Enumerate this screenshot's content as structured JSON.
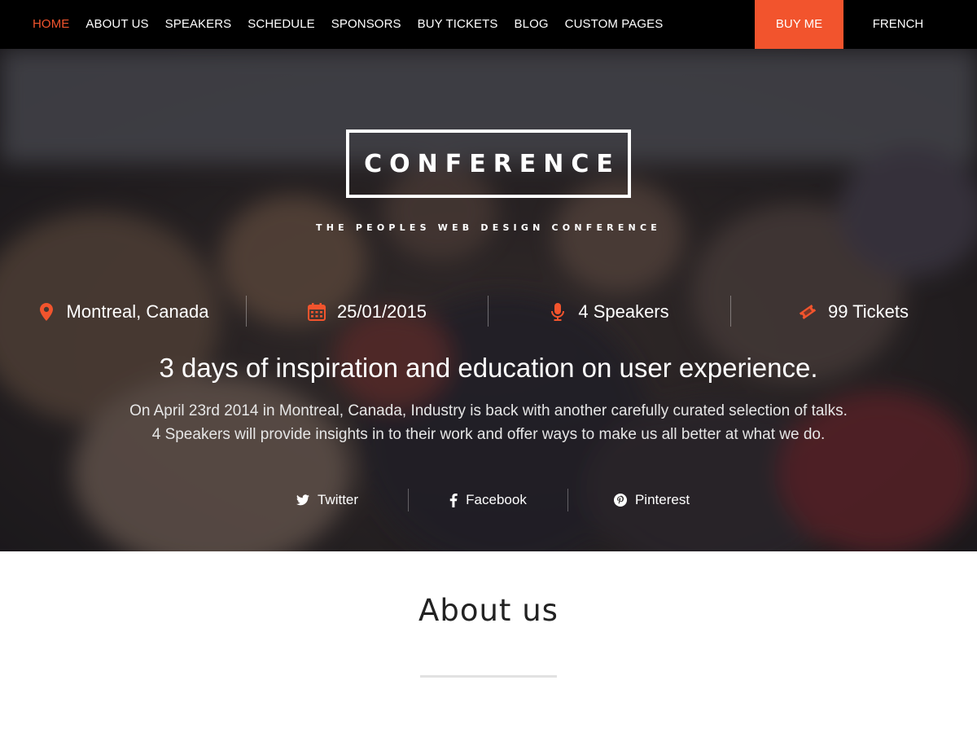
{
  "nav": {
    "items": [
      {
        "label": "HOME",
        "active": true
      },
      {
        "label": "ABOUT US"
      },
      {
        "label": "SPEAKERS"
      },
      {
        "label": "SCHEDULE"
      },
      {
        "label": "SPONSORS"
      },
      {
        "label": "BUY TICKETS"
      },
      {
        "label": "BLOG"
      },
      {
        "label": "CUSTOM PAGES"
      }
    ],
    "buy_label": "BUY ME",
    "language": "FRENCH"
  },
  "hero": {
    "logo": "CONFERENCE",
    "tagline": "THE PEOPLES WEB DESIGN CONFERENCE",
    "info": [
      {
        "icon": "map-pin-icon",
        "text": "Montreal, Canada"
      },
      {
        "icon": "calendar-icon",
        "text": "25/01/2015"
      },
      {
        "icon": "microphone-icon",
        "text": "4 Speakers"
      },
      {
        "icon": "ticket-icon",
        "text": "99 Tickets"
      }
    ],
    "headline": "3 days of inspiration and education on user experience.",
    "description_line1": "On April 23rd 2014 in Montreal, Canada, Industry is back with another carefully curated selection of talks.",
    "description_line2": "4 Speakers will provide insights in to their work and offer ways to make us all better at what we do.",
    "social": [
      {
        "icon": "twitter-icon",
        "label": "Twitter"
      },
      {
        "icon": "facebook-icon",
        "label": "Facebook"
      },
      {
        "icon": "pinterest-icon",
        "label": "Pinterest"
      }
    ]
  },
  "about": {
    "title": "About us"
  },
  "colors": {
    "accent": "#f2542d",
    "nav_bg": "#000000"
  }
}
